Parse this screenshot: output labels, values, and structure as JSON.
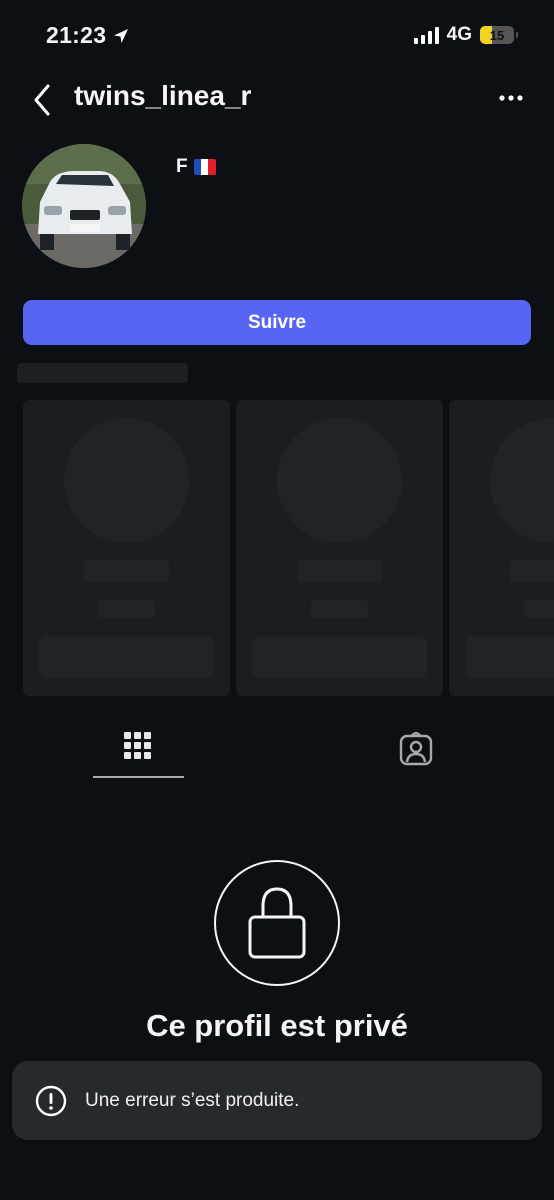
{
  "status_bar": {
    "time": "21:23",
    "network": "4G",
    "battery": "15"
  },
  "header": {
    "username": "twins_linea_r"
  },
  "profile": {
    "bio": "F"
  },
  "actions": {
    "follow_label": "Suivre"
  },
  "private": {
    "title": "Ce profil est privé"
  },
  "toast": {
    "message": "Une erreur s’est produite."
  },
  "colors": {
    "accent": "#5865f2",
    "background": "#0c1014",
    "battery_fill": "#f2d024"
  }
}
